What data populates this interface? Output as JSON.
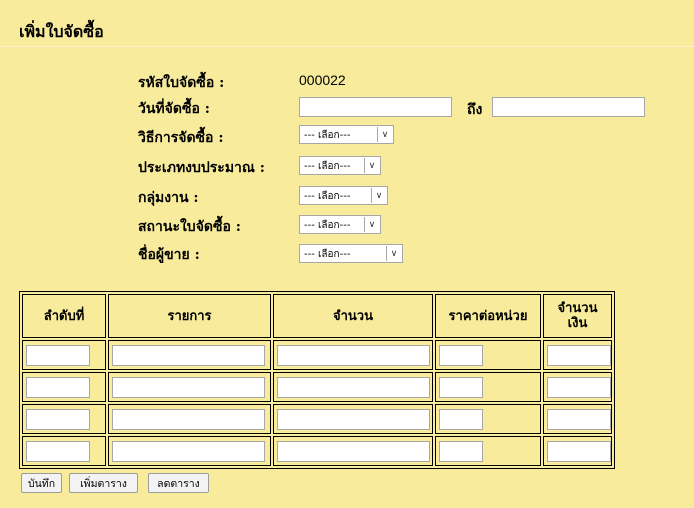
{
  "page": {
    "title": "เพิ่มใบจัดซื้อ"
  },
  "form": {
    "po_number": {
      "label": "รหัสใบจัดซื้อ :",
      "value": "000022"
    },
    "date": {
      "label": "วันที่จัดซื้อ :",
      "to_label": "ถึง",
      "from_value": "",
      "to_value": ""
    },
    "method": {
      "label": "วิธีการจัดซื้อ :",
      "selected": "--- เลือก---"
    },
    "budget_type": {
      "label": "ประเภทงบประมาณ :",
      "selected": "--- เลือก---"
    },
    "work_group": {
      "label": "กลุ่มงาน :",
      "selected": "--- เลือก---"
    },
    "status": {
      "label": "สถานะใบจัดซื้อ :",
      "selected": "--- เลือก---"
    },
    "vendor": {
      "label": "ชื่อผู้ขาย :",
      "selected": "--- เลือก---"
    }
  },
  "table": {
    "headers": [
      "ลำดับที่",
      "รายการ",
      "จำนวน",
      "ราคาต่อหน่วย",
      "จำนวน\nเงิน"
    ],
    "rows": [
      [
        "",
        "",
        "",
        "",
        ""
      ],
      [
        "",
        "",
        "",
        "",
        ""
      ],
      [
        "",
        "",
        "",
        "",
        ""
      ],
      [
        "",
        "",
        "",
        "",
        ""
      ]
    ]
  },
  "buttons": {
    "save": "บันทึก",
    "add_row": "เพิ่มตาราง",
    "remove_row": "ลดตาราง"
  },
  "icons": {
    "select_arrow": "chevron-down-icon"
  }
}
